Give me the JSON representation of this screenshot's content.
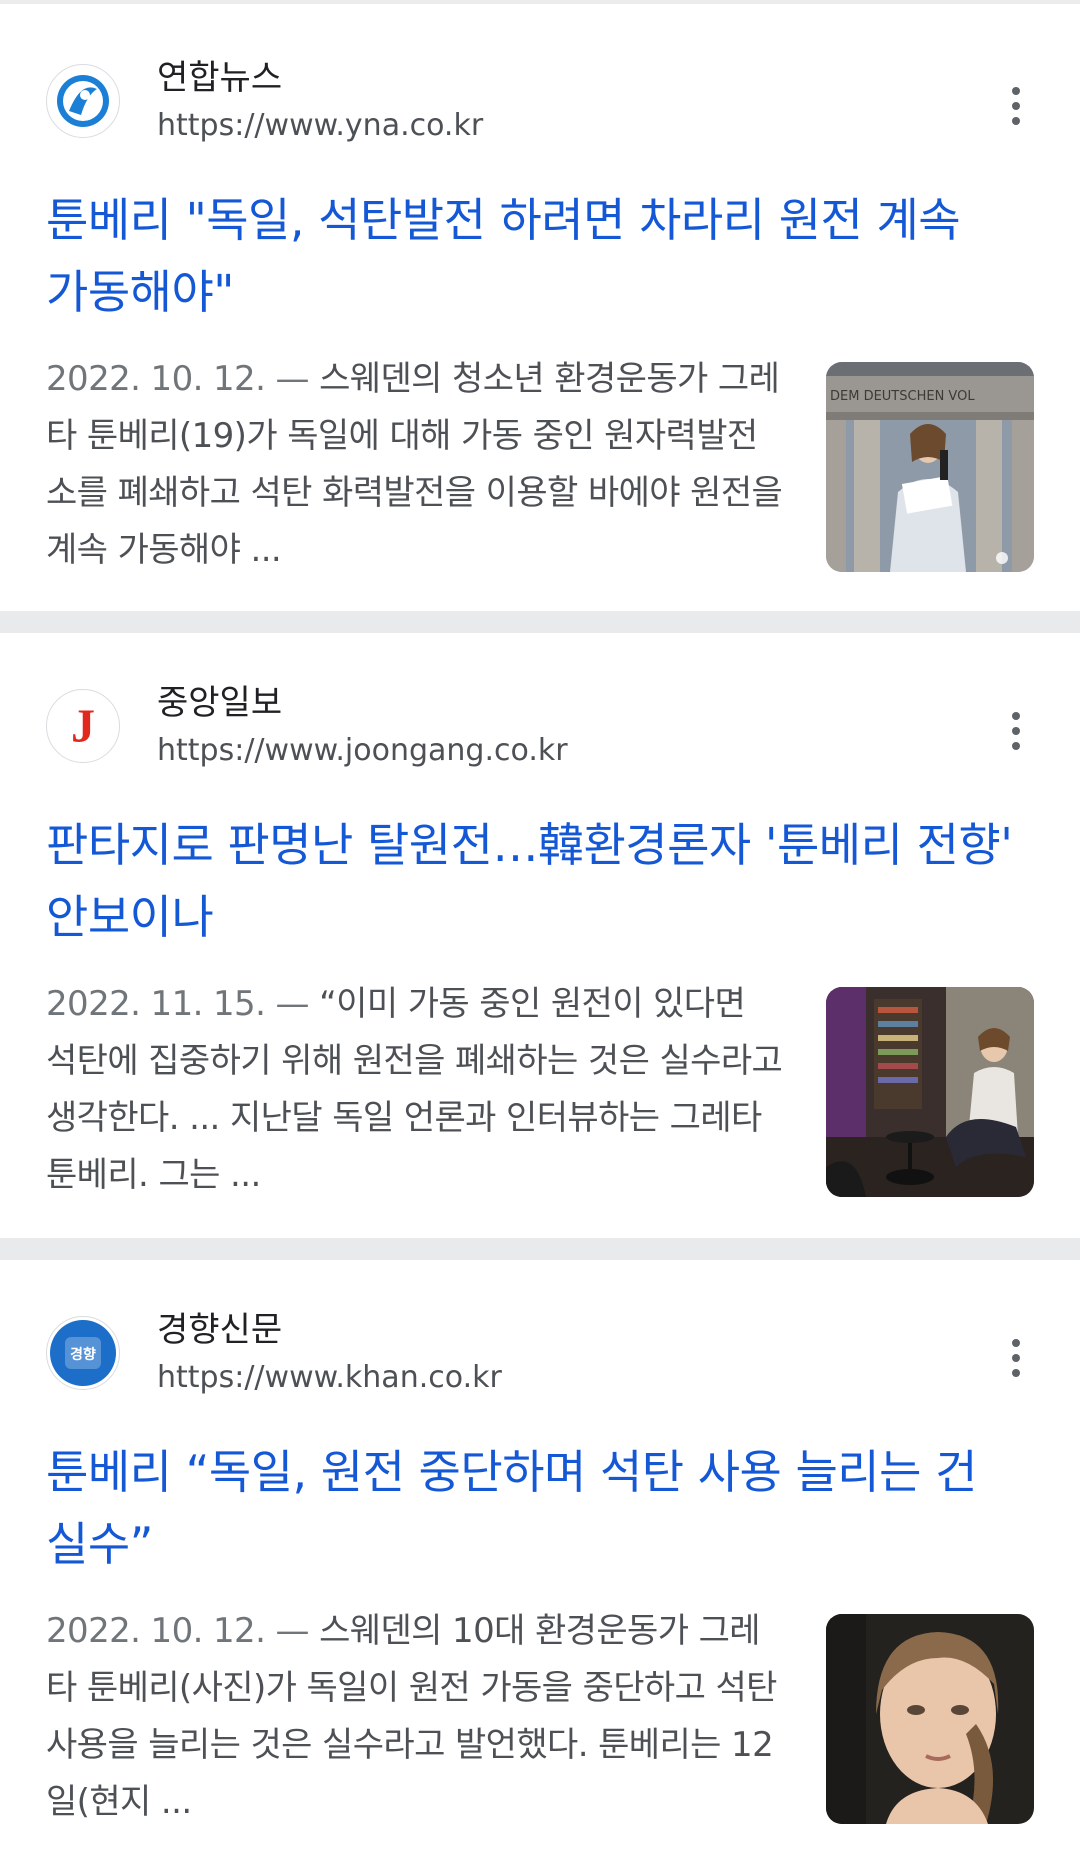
{
  "results": [
    {
      "source_name": "연합뉴스",
      "source_url": "https://www.yna.co.kr",
      "logo_icon": "yonhap-logo-icon",
      "title": "툰베리 \"독일, 석탄발전 하려면 차라리 원전 계속 가동해야\"",
      "date": "2022. 10. 12. —",
      "snippet": "스웨덴의 청소년 환경운동가 그레타 툰베리(19)가 독일에 대해 가동 중인 원자력발전소를 폐쇄하고 석탄 화력발전을 이용할 바에야 원전을 계속 가동해야 ...",
      "thumbnail_text": "DEM DEUTSCHEN VOL"
    },
    {
      "source_name": "중앙일보",
      "source_url": "https://www.joongang.co.kr",
      "logo_icon": "joongang-logo-icon",
      "logo_letter": "J",
      "title": "판타지로 판명난 탈원전…韓환경론자 '툰베리 전향' 안보이나",
      "date": "2022. 11. 15. —",
      "snippet": "“이미 가동 중인 원전이 있다면 석탄에 집중하기 위해 원전을 폐쇄하는 것은 실수라고 생각한다. ... 지난달 독일 언론과 인터뷰하는 그레타 툰베리. 그는 ..."
    },
    {
      "source_name": "경향신문",
      "source_url": "https://www.khan.co.kr",
      "logo_icon": "kyunghyang-logo-icon",
      "logo_letter": "경향",
      "title": "툰베리 “독일, 원전 중단하며 석탄 사용 늘리는 건 실수”",
      "date": "2022. 10. 12. —",
      "snippet": "스웨덴의 10대 환경운동가 그레타 툰베리(사진)가 독일이 원전 가동을 중단하고 석탄 사용을 늘리는 것은 실수라고 발언했다. 툰베리는 12일(현지 ..."
    }
  ],
  "more_icon": "more-vert-icon",
  "colors": {
    "title_link": "#1558d6",
    "snippet": "#4d5156",
    "divider": "#e9eaec"
  }
}
